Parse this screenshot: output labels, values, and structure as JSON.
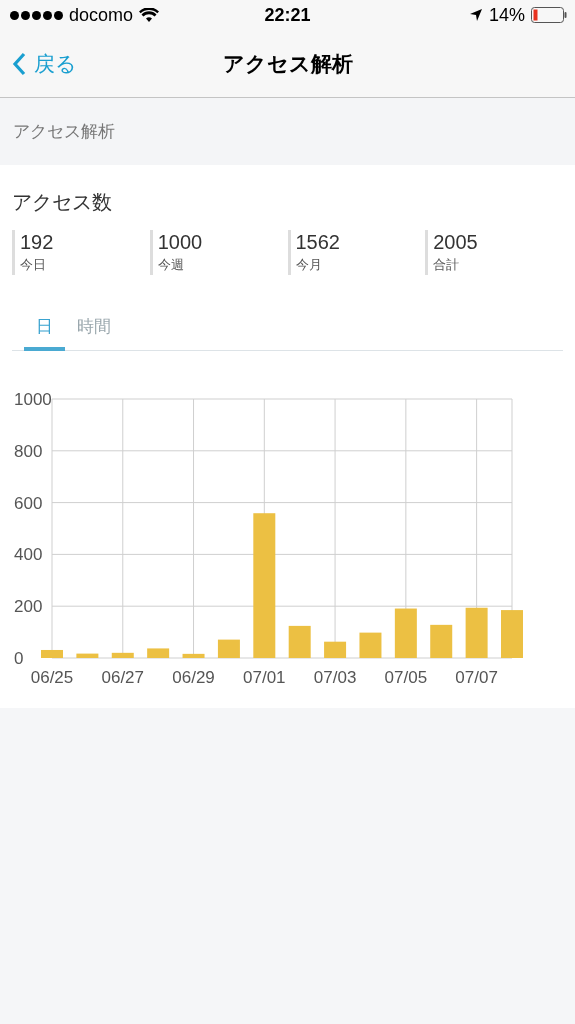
{
  "status_bar": {
    "carrier": "docomo",
    "time": "22:21",
    "battery": "14%"
  },
  "nav_bar": {
    "back": "戻る",
    "title": "アクセス解析"
  },
  "section_header": "アクセス解析",
  "card": {
    "title": "アクセス数",
    "stats": [
      {
        "value": "192",
        "label": "今日"
      },
      {
        "value": "1000",
        "label": "今週"
      },
      {
        "value": "1562",
        "label": "今月"
      },
      {
        "value": "2005",
        "label": "合計"
      }
    ],
    "tabs": [
      {
        "label": "日",
        "selected": true
      },
      {
        "label": "時間",
        "selected": false
      }
    ],
    "chart_data": {
      "type": "bar",
      "ylim": [
        0,
        1000
      ],
      "yticks": [
        0,
        200,
        400,
        600,
        800,
        1000
      ],
      "grid": true,
      "categories": [
        "06/25",
        null,
        "06/27",
        null,
        "06/29",
        null,
        "07/01",
        null,
        "07/03",
        null,
        "07/05",
        null,
        "07/07",
        null
      ],
      "series": [
        {
          "color": "#ecc043",
          "values": [
            31,
            17,
            20,
            37,
            16,
            71,
            559,
            124,
            63,
            98,
            191,
            128,
            194,
            185
          ]
        }
      ]
    }
  }
}
